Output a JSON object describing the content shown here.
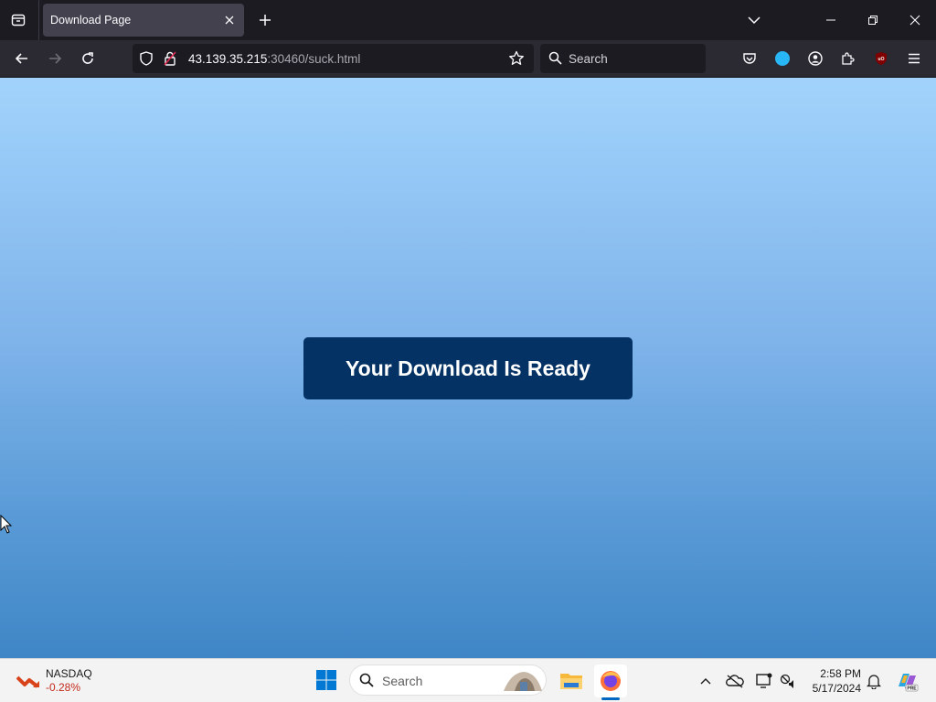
{
  "browser": {
    "tab_title": "Download Page",
    "url_host": "43.139.35.215",
    "url_rest": ":30460/suck.html",
    "search_placeholder": "Search"
  },
  "page": {
    "download_button_label": "Your Download Is Ready",
    "colors": {
      "gradient_top": "#a2d3fc",
      "gradient_bottom": "#3f86c6",
      "button_bg": "#043264",
      "button_text": "#ffffff"
    }
  },
  "taskbar": {
    "stock_name": "NASDAQ",
    "stock_change": "-0.28%",
    "search_placeholder": "Search",
    "pinned_apps": [
      "file-explorer-icon",
      "firefox-icon"
    ],
    "tray_icons": [
      "chevron-up-icon",
      "onedrive-offline-icon",
      "display-icon",
      "network-volume-icon",
      "bell-icon",
      "copilot-icon"
    ],
    "clock_time": "2:58 PM",
    "clock_date": "5/17/2024"
  }
}
